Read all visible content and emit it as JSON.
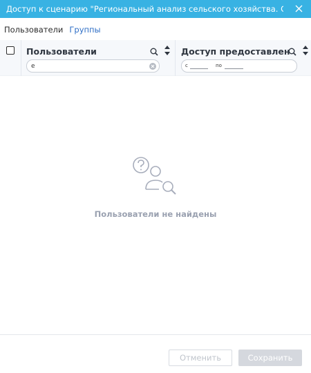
{
  "window": {
    "title": "Доступ к сценарию  \"Региональный анализ сельского хозяйства. Структура, э...",
    "title_bar_color": "#38b2e3",
    "close_icon": "close-icon"
  },
  "tabs": [
    {
      "label": "Пользователи"
    },
    {
      "label": "Группы"
    }
  ],
  "table": {
    "columns": [
      {
        "title": "Пользователи",
        "filter_value": "e"
      },
      {
        "title": "Доступ предоставлен",
        "date_from_label": "с",
        "date_to_label": "по"
      }
    ]
  },
  "empty_state": {
    "icon": "user-search-icon",
    "message": "Пользователи не найдены"
  },
  "footer": {
    "cancel_label": "Отменить",
    "save_label": "Сохранить"
  },
  "colors": {
    "accent": "#38b2e3",
    "link": "#2f6fc6",
    "muted_text": "#9aa1b0"
  }
}
